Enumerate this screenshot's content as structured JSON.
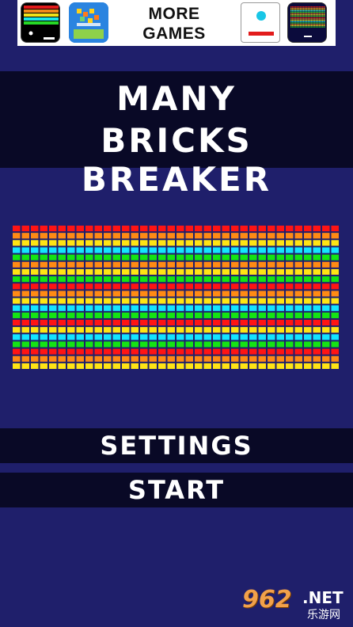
{
  "ad_banner": {
    "more_games_line1": "MORE",
    "more_games_line2": "GAMES",
    "apps": [
      {
        "icon": "breakout-game-icon"
      },
      {
        "icon": "tile-puzzle-game-icon"
      },
      {
        "icon": "ball-paddle-game-icon"
      },
      {
        "icon": "bricks-game-icon"
      }
    ]
  },
  "title": {
    "line1": "MANY",
    "line2": "BRICKS BREAKER"
  },
  "brick_preview": {
    "columns": 36,
    "row_colors": [
      "#ff1a1a",
      "#ff8c1a",
      "#ffe11a",
      "#1ae5ff",
      "#1ae81a",
      "#ffe11a",
      "#ff8c1a",
      "#1ae81a"
    ],
    "row_pattern_count": 20,
    "pattern": [
      "red",
      "orange",
      "yellow",
      "cyan",
      "green",
      "orange",
      "yellow",
      "green",
      "red",
      "orange",
      "yellow",
      "cyan",
      "green",
      "red",
      "yellow",
      "cyan",
      "green",
      "red",
      "orange",
      "yellow"
    ],
    "palette": {
      "red": "#ff1414",
      "orange": "#ff8a14",
      "yellow": "#ffe414",
      "cyan": "#14e4ff",
      "green": "#14e414"
    }
  },
  "menu": {
    "settings_label": "SETTINGS",
    "start_label": "START"
  },
  "watermark": {
    "main": "962",
    "net": ".NET",
    "sub": "乐游网"
  },
  "colors": {
    "background": "#1f1f6b",
    "band": "#090926",
    "text": "#ffffff"
  }
}
